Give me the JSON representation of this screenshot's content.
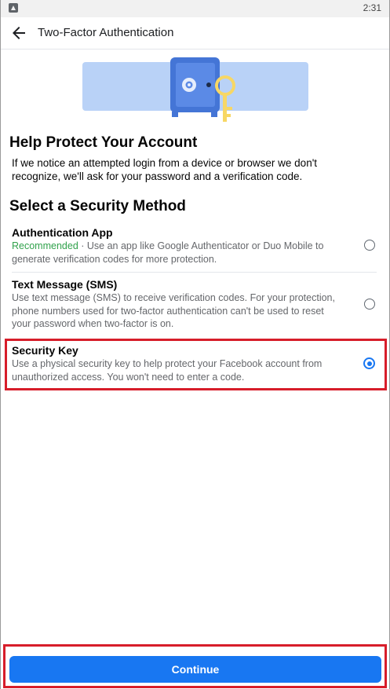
{
  "status_bar": {
    "time": "2:31"
  },
  "header": {
    "title": "Two-Factor Authentication"
  },
  "section_1": {
    "heading": "Help Protect Your Account",
    "body": "If we notice an attempted login from a device or browser we don't recognize, we'll ask for your password and a verification code."
  },
  "section_2": {
    "heading": "Select a Security Method"
  },
  "options": [
    {
      "title": "Authentication App",
      "badge": "Recommended",
      "description": " · Use an app like Google Authenticator or Duo Mobile to generate verification codes for more protection.",
      "selected": false
    },
    {
      "title": "Text Message (SMS)",
      "description": "Use text message (SMS) to receive verification codes. For your protection, phone numbers used for two-factor authentication can't be used to reset your password when two-factor is on.",
      "selected": false
    },
    {
      "title": "Security Key",
      "description": "Use a physical security key to help protect your Facebook account from unauthorized access. You won't need to enter a code.",
      "selected": true
    }
  ],
  "footer": {
    "continue_label": "Continue"
  },
  "colors": {
    "accent": "#1877f2",
    "recommended": "#31a24c",
    "highlight": "#d71d2a"
  }
}
